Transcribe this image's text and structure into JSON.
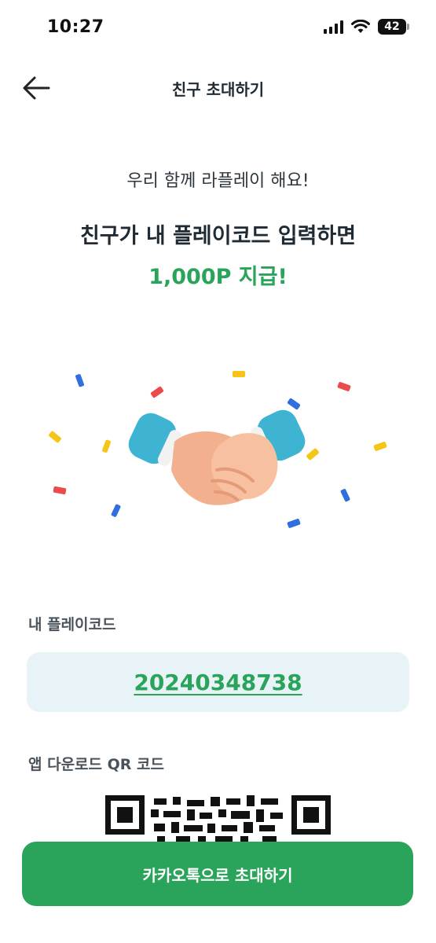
{
  "status_bar": {
    "time": "10:27",
    "battery": "42"
  },
  "header": {
    "title": "친구 초대하기"
  },
  "hero": {
    "subtitle": "우리 함께 라플레이 해요!",
    "headline": "친구가 내 플레이코드 입력하면",
    "reward": "1,000P 지급!"
  },
  "playcode": {
    "label": "내 플레이코드",
    "value": "20240348738"
  },
  "qr": {
    "label": "앱 다운로드 QR 코드"
  },
  "cta": {
    "label": "카카오톡으로 초대하기"
  },
  "colors": {
    "accent": "#2aa35b",
    "code_bg": "#e8f3f7"
  },
  "icons": [
    "back-arrow-icon",
    "signal-icon",
    "wifi-icon",
    "battery-icon",
    "handshake-icon",
    "qr-code-icon"
  ]
}
